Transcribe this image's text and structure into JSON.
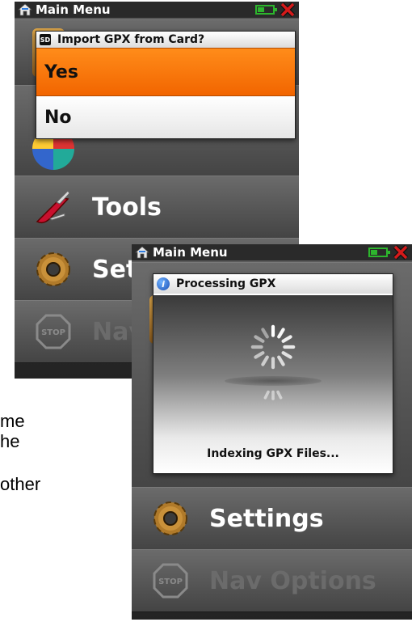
{
  "document_fragments": [
    "me",
    "he",
    "other"
  ],
  "back_screen": {
    "status": {
      "title": "Main Menu"
    },
    "dialog": {
      "sd_badge": "SD",
      "title": "Import GPX from Card?",
      "options": [
        "Yes",
        "No"
      ],
      "selected": "Yes"
    },
    "menu": [
      {
        "label": "Tools",
        "icon": "pocket-knife-icon"
      },
      {
        "label": "Set",
        "icon": "gear-icon"
      },
      {
        "label": "Nav",
        "icon": "stop-sign-icon",
        "disabled": true
      }
    ]
  },
  "front_screen": {
    "status": {
      "title": "Main Menu"
    },
    "dialog": {
      "title": "Processing GPX",
      "status_text": "Indexing GPX Files..."
    },
    "menu": [
      {
        "label": "Settings",
        "icon": "gear-icon"
      },
      {
        "label": "Nav Options",
        "icon": "stop-sign-icon",
        "disabled": true
      }
    ]
  },
  "colors": {
    "selected_option": "#f26500",
    "battery": "#2db52d",
    "close_x": "#d61a1a",
    "info": "#1a4fb5"
  }
}
